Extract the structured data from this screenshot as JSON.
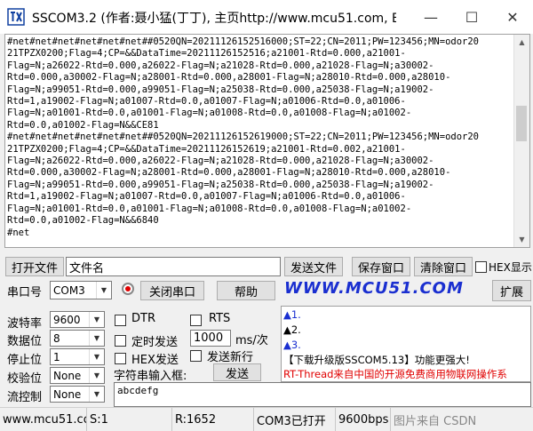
{
  "window": {
    "title": "SSCOM3.2 (作者:聂小猛(丁丁), 主页http://www.mcu51.com, E...",
    "minimize_glyph": "—",
    "maximize_glyph": "☐",
    "close_glyph": "✕"
  },
  "receive": {
    "lines": [
      "#net#net#net#net#net#net##0520QN=20211126152516000;ST=22;CN=2011;PW=123456;MN=odor20",
      "21TPZX0200;Flag=4;CP=&&DataTime=20211126152516;a21001-Rtd=0.000,a21001-",
      "Flag=N;a26022-Rtd=0.000,a26022-Flag=N;a21028-Rtd=0.000,a21028-Flag=N;a30002-",
      "Rtd=0.000,a30002-Flag=N;a28001-Rtd=0.000,a28001-Flag=N;a28010-Rtd=0.000,a28010-",
      "Flag=N;a99051-Rtd=0.000,a99051-Flag=N;a25038-Rtd=0.000,a25038-Flag=N;a19002-",
      "Rtd=1,a19002-Flag=N;a01007-Rtd=0.0,a01007-Flag=N;a01006-Rtd=0.0,a01006-",
      "Flag=N;a01001-Rtd=0.0,a01001-Flag=N;a01008-Rtd=0.0,a01008-Flag=N;a01002-",
      "Rtd=0.0,a01002-Flag=N&&CE81",
      "#net#net#net#net#net#net##0520QN=20211126152619000;ST=22;CN=2011;PW=123456;MN=odor20",
      "21TPZX0200;Flag=4;CP=&&DataTime=20211126152619;a21001-Rtd=0.002,a21001-",
      "Flag=N;a26022-Rtd=0.000,a26022-Flag=N;a21028-Rtd=0.000,a21028-Flag=N;a30002-",
      "Rtd=0.000,a30002-Flag=N;a28001-Rtd=0.000,a28001-Flag=N;a28010-Rtd=0.000,a28010-",
      "Flag=N;a99051-Rtd=0.000,a99051-Flag=N;a25038-Rtd=0.000,a25038-Flag=N;a19002-",
      "Rtd=1,a19002-Flag=N;a01007-Rtd=0.0,a01007-Flag=N;a01006-Rtd=0.0,a01006-",
      "Flag=N;a01001-Rtd=0.0,a01001-Flag=N;a01008-Rtd=0.0,a01008-Flag=N;a01002-",
      "Rtd=0.0,a01002-Flag=N&&6840",
      "#net"
    ]
  },
  "file_row": {
    "open_file_label": "打开文件",
    "filename_value": "文件名",
    "send_file_label": "发送文件",
    "save_window_label": "保存窗口",
    "clear_window_label": "清除窗口",
    "hex_display_label": "HEX显示"
  },
  "port_row": {
    "port_label": "串口号",
    "port_value": "COM3",
    "close_port_label": "关闭串口",
    "help_label": "帮助",
    "logo_text": "WWW.MCU51.COM",
    "expand_label": "扩展"
  },
  "settings": {
    "baud_label": "波特率",
    "baud_value": "9600",
    "databits_label": "数据位",
    "databits_value": "8",
    "stopbits_label": "停止位",
    "stopbits_value": "1",
    "parity_label": "校验位",
    "parity_value": "None",
    "flow_label": "流控制",
    "flow_value": "None"
  },
  "options": {
    "dtr_label": "DTR",
    "rts_label": "RTS",
    "timed_send_label": "定时发送",
    "interval_value": "1000",
    "interval_unit": "ms/次",
    "hex_send_label": "HEX发送",
    "send_newline_label": "发送新行",
    "input_label": "字符串输入框:",
    "send_label": "发送"
  },
  "messages": {
    "line1": "1.",
    "line2": "2.",
    "line3": "3.",
    "line4": "【下载升级版SSCOM5.13】功能更强大!",
    "line5": "RT-Thread来自中国的开源免费商用物联网操作系"
  },
  "send_text": "abcdefg",
  "status": {
    "website": "www.mcu51.cor",
    "sent": "S:1",
    "received": "R:1652",
    "port_state": "COM3已打开",
    "settings": "9600bps",
    "watermark": "图片来自 CSDN"
  },
  "colors": {
    "logo": "#1a2fd0",
    "link_blue": "#1a2fd0",
    "rt_thread_red": "#e00000"
  }
}
